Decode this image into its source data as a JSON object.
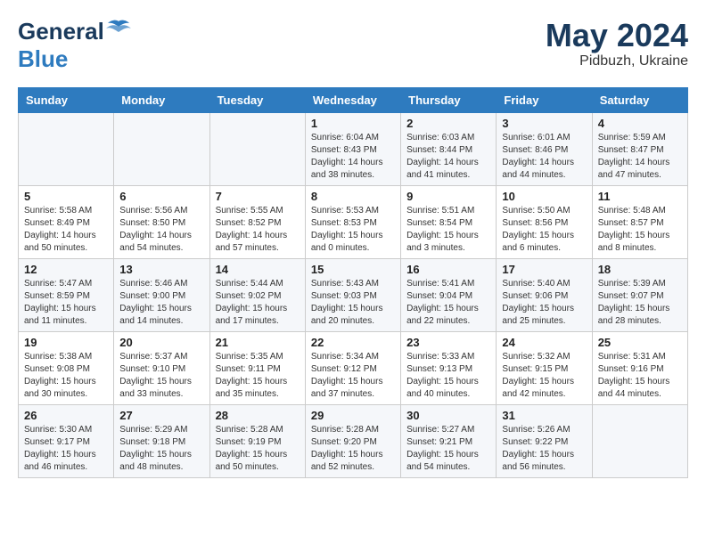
{
  "header": {
    "logo_general": "General",
    "logo_blue": "Blue",
    "month_year": "May 2024",
    "location": "Pidbuzh, Ukraine"
  },
  "weekdays": [
    "Sunday",
    "Monday",
    "Tuesday",
    "Wednesday",
    "Thursday",
    "Friday",
    "Saturday"
  ],
  "weeks": [
    [
      {
        "day": "",
        "info": ""
      },
      {
        "day": "",
        "info": ""
      },
      {
        "day": "",
        "info": ""
      },
      {
        "day": "1",
        "info": "Sunrise: 6:04 AM\nSunset: 8:43 PM\nDaylight: 14 hours\nand 38 minutes."
      },
      {
        "day": "2",
        "info": "Sunrise: 6:03 AM\nSunset: 8:44 PM\nDaylight: 14 hours\nand 41 minutes."
      },
      {
        "day": "3",
        "info": "Sunrise: 6:01 AM\nSunset: 8:46 PM\nDaylight: 14 hours\nand 44 minutes."
      },
      {
        "day": "4",
        "info": "Sunrise: 5:59 AM\nSunset: 8:47 PM\nDaylight: 14 hours\nand 47 minutes."
      }
    ],
    [
      {
        "day": "5",
        "info": "Sunrise: 5:58 AM\nSunset: 8:49 PM\nDaylight: 14 hours\nand 50 minutes."
      },
      {
        "day": "6",
        "info": "Sunrise: 5:56 AM\nSunset: 8:50 PM\nDaylight: 14 hours\nand 54 minutes."
      },
      {
        "day": "7",
        "info": "Sunrise: 5:55 AM\nSunset: 8:52 PM\nDaylight: 14 hours\nand 57 minutes."
      },
      {
        "day": "8",
        "info": "Sunrise: 5:53 AM\nSunset: 8:53 PM\nDaylight: 15 hours\nand 0 minutes."
      },
      {
        "day": "9",
        "info": "Sunrise: 5:51 AM\nSunset: 8:54 PM\nDaylight: 15 hours\nand 3 minutes."
      },
      {
        "day": "10",
        "info": "Sunrise: 5:50 AM\nSunset: 8:56 PM\nDaylight: 15 hours\nand 6 minutes."
      },
      {
        "day": "11",
        "info": "Sunrise: 5:48 AM\nSunset: 8:57 PM\nDaylight: 15 hours\nand 8 minutes."
      }
    ],
    [
      {
        "day": "12",
        "info": "Sunrise: 5:47 AM\nSunset: 8:59 PM\nDaylight: 15 hours\nand 11 minutes."
      },
      {
        "day": "13",
        "info": "Sunrise: 5:46 AM\nSunset: 9:00 PM\nDaylight: 15 hours\nand 14 minutes."
      },
      {
        "day": "14",
        "info": "Sunrise: 5:44 AM\nSunset: 9:02 PM\nDaylight: 15 hours\nand 17 minutes."
      },
      {
        "day": "15",
        "info": "Sunrise: 5:43 AM\nSunset: 9:03 PM\nDaylight: 15 hours\nand 20 minutes."
      },
      {
        "day": "16",
        "info": "Sunrise: 5:41 AM\nSunset: 9:04 PM\nDaylight: 15 hours\nand 22 minutes."
      },
      {
        "day": "17",
        "info": "Sunrise: 5:40 AM\nSunset: 9:06 PM\nDaylight: 15 hours\nand 25 minutes."
      },
      {
        "day": "18",
        "info": "Sunrise: 5:39 AM\nSunset: 9:07 PM\nDaylight: 15 hours\nand 28 minutes."
      }
    ],
    [
      {
        "day": "19",
        "info": "Sunrise: 5:38 AM\nSunset: 9:08 PM\nDaylight: 15 hours\nand 30 minutes."
      },
      {
        "day": "20",
        "info": "Sunrise: 5:37 AM\nSunset: 9:10 PM\nDaylight: 15 hours\nand 33 minutes."
      },
      {
        "day": "21",
        "info": "Sunrise: 5:35 AM\nSunset: 9:11 PM\nDaylight: 15 hours\nand 35 minutes."
      },
      {
        "day": "22",
        "info": "Sunrise: 5:34 AM\nSunset: 9:12 PM\nDaylight: 15 hours\nand 37 minutes."
      },
      {
        "day": "23",
        "info": "Sunrise: 5:33 AM\nSunset: 9:13 PM\nDaylight: 15 hours\nand 40 minutes."
      },
      {
        "day": "24",
        "info": "Sunrise: 5:32 AM\nSunset: 9:15 PM\nDaylight: 15 hours\nand 42 minutes."
      },
      {
        "day": "25",
        "info": "Sunrise: 5:31 AM\nSunset: 9:16 PM\nDaylight: 15 hours\nand 44 minutes."
      }
    ],
    [
      {
        "day": "26",
        "info": "Sunrise: 5:30 AM\nSunset: 9:17 PM\nDaylight: 15 hours\nand 46 minutes."
      },
      {
        "day": "27",
        "info": "Sunrise: 5:29 AM\nSunset: 9:18 PM\nDaylight: 15 hours\nand 48 minutes."
      },
      {
        "day": "28",
        "info": "Sunrise: 5:28 AM\nSunset: 9:19 PM\nDaylight: 15 hours\nand 50 minutes."
      },
      {
        "day": "29",
        "info": "Sunrise: 5:28 AM\nSunset: 9:20 PM\nDaylight: 15 hours\nand 52 minutes."
      },
      {
        "day": "30",
        "info": "Sunrise: 5:27 AM\nSunset: 9:21 PM\nDaylight: 15 hours\nand 54 minutes."
      },
      {
        "day": "31",
        "info": "Sunrise: 5:26 AM\nSunset: 9:22 PM\nDaylight: 15 hours\nand 56 minutes."
      },
      {
        "day": "",
        "info": ""
      }
    ]
  ]
}
